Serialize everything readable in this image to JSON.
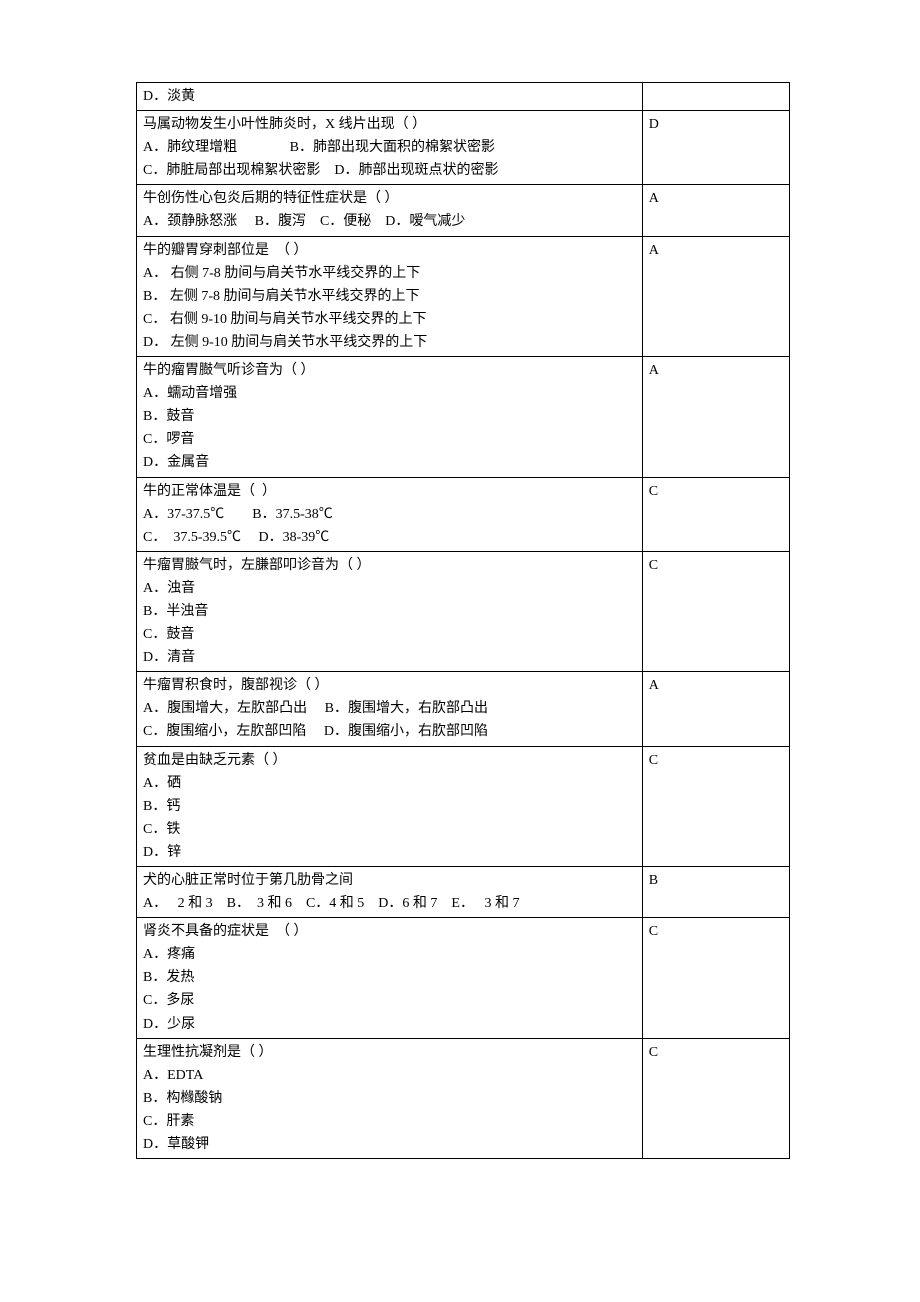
{
  "rows": [
    {
      "question_lines": [
        "D．淡黄"
      ],
      "answer": ""
    },
    {
      "question_lines": [
        "马属动物发生小叶性肺炎时，X 线片出现（ ）",
        "A．肺纹理增粗               B．肺部出现大面积的棉絮状密影",
        "C．肺脏局部出现棉絮状密影    D．肺部出现斑点状的密影"
      ],
      "answer": "D"
    },
    {
      "question_lines": [
        "牛创伤性心包炎后期的特征性症状是（ ）",
        "A．颈静脉怒涨     B．腹泻    C．便秘    D．嗳气减少"
      ],
      "answer": "A"
    },
    {
      "question_lines": [
        "牛的瓣胃穿刺部位是  （ ）",
        "A． 右侧 7-8 肋间与肩关节水平线交界的上下",
        "B． 左侧 7-8 肋间与肩关节水平线交界的上下",
        "C． 右侧 9-10 肋间与肩关节水平线交界的上下",
        "D． 左侧 9-10 肋间与肩关节水平线交界的上下"
      ],
      "answer": "A"
    },
    {
      "question_lines": [
        "牛的瘤胃臌气听诊音为（ ）",
        "A．蠕动音增强",
        "B．鼓音",
        "C．啰音",
        "D．金属音"
      ],
      "answer": "A"
    },
    {
      "question_lines": [
        "牛的正常体温是（  ）",
        "A．37-37.5℃        B．37.5-38℃",
        "C．  37.5-39.5℃     D．38-39℃"
      ],
      "answer": "C"
    },
    {
      "question_lines": [
        "牛瘤胃臌气时，左膁部叩诊音为（ ）",
        "A．浊音",
        "B．半浊音",
        "C．鼓音",
        "D．清音"
      ],
      "answer": "C"
    },
    {
      "question_lines": [
        "牛瘤胃积食时，腹部视诊（ ）",
        "A．腹围增大，左肷部凸出     B．腹围增大，右肷部凸出",
        "C．腹围缩小，左肷部凹陷     D．腹围缩小，右肷部凹陷"
      ],
      "answer": "A"
    },
    {
      "question_lines": [
        "贫血是由缺乏元素（ ）",
        "A．硒",
        "B．钙",
        "C．铁",
        "D．锌"
      ],
      "answer": "C"
    },
    {
      "question_lines": [
        "犬的心脏正常时位于第几肋骨之间",
        "A．   2 和 3    B．  3 和 6    C．4 和 5    D．6 和 7    E．   3 和 7"
      ],
      "answer": "B"
    },
    {
      "question_lines": [
        "肾炎不具备的症状是  （ ）",
        "A．疼痛",
        "B．发热",
        "C．多尿",
        "D．少尿"
      ],
      "answer": "C"
    },
    {
      "question_lines": [
        "生理性抗凝剂是（ ）",
        "A．EDTA",
        "B．构橼酸钠",
        "C．肝素",
        "D．草酸钾"
      ],
      "answer": "C"
    }
  ]
}
